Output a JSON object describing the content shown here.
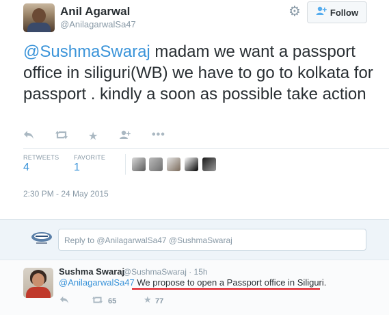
{
  "author": {
    "name": "Anil Agarwal",
    "handle": "@AnilagarwalSa47"
  },
  "header": {
    "follow_label": "Follow"
  },
  "tweet": {
    "mention": "@SushmaSwaraj",
    "text": "  madam we want a passport office in siliguri(WB) we have to go to kolkata for passport . kindly a soon as possible take action",
    "retweets_label": "RETWEETS",
    "retweets_count": "4",
    "favorite_label": "FAVORITE",
    "favorite_count": "1",
    "timestamp": "2:30 PM - 24 May 2015"
  },
  "reply_box": {
    "placeholder": "Reply to @AnilagarwalSa47 @SushmaSwaraj"
  },
  "reply": {
    "name": "Sushma Swaraj",
    "handle_time": "@SushmaSwaraj · 15h",
    "mention": "@AnilagarwalSa47",
    "text": " We propose to open a Passport office in Siliguri.",
    "retweet_count": "65",
    "favorite_count": "77"
  },
  "colors": {
    "link": "#3b94d9",
    "highlight_underline": "#e0121b",
    "muted": "#8899a6"
  }
}
